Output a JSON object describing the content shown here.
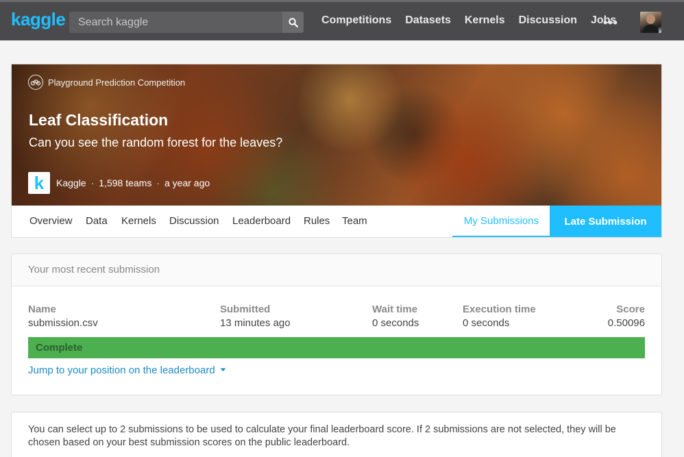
{
  "nav": {
    "logo": "kaggle",
    "search_placeholder": "Search kaggle",
    "links": [
      "Competitions",
      "Datasets",
      "Kernels",
      "Discussion",
      "Jobs"
    ],
    "more": "•••"
  },
  "competition": {
    "type_label": "Playground Prediction Competition",
    "title": "Leaf Classification",
    "subtitle": "Can you see the random forest for the leaves?",
    "host_logo_letter": "k",
    "host": "Kaggle",
    "teams": "1,598 teams",
    "age": "a year ago"
  },
  "tabs": [
    "Overview",
    "Data",
    "Kernels",
    "Discussion",
    "Leaderboard",
    "Rules",
    "Team"
  ],
  "tab_active": "My Submissions",
  "late_submission_label": "Late Submission",
  "recent": {
    "heading": "Your most recent submission",
    "name_header": "Name",
    "name_value": "submission.csv",
    "submitted_header": "Submitted",
    "submitted_value": "13 minutes ago",
    "wait_header": "Wait time",
    "wait_value": "0 seconds",
    "exec_header": "Execution time",
    "exec_value": "0 seconds",
    "score_header": "Score",
    "score_value": "0.50096",
    "status": "Complete",
    "jump_link": "Jump to your position on the leaderboard"
  },
  "info": {
    "text": "You can select up to 2 submissions to be used to calculate your final leaderboard score. If 2 submissions are not selected, they will be chosen based on your best submission scores on the public leaderboard."
  },
  "colors": {
    "accent": "#20beff",
    "nav_bg": "#4a4a4c",
    "complete": "#4caf50",
    "link": "#1a8ac6"
  }
}
